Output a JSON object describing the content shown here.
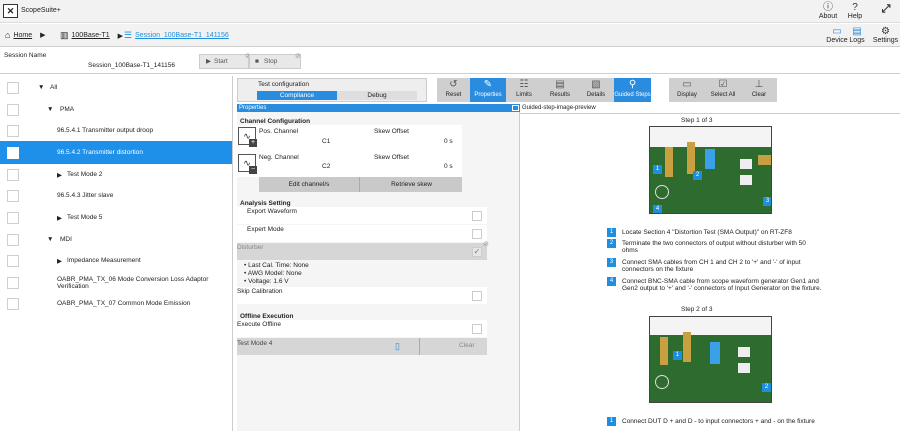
{
  "app": {
    "title": "ScopeSuite+"
  },
  "topbar": {
    "about": "About",
    "help": "Help",
    "device": "Device",
    "logs": "Logs",
    "settings": "Settings"
  },
  "breadcrumb": {
    "home": "Home",
    "test": "100Base-T1",
    "session": "Session_100Base-T1_141156"
  },
  "session": {
    "label": "Session Name",
    "value": "Session_100Base-T1_141156",
    "start": "Start",
    "stop": "Stop"
  },
  "tree": [
    {
      "label": "All",
      "type": "expanded"
    },
    {
      "label": "PMA",
      "type": "expanded"
    },
    {
      "label": "96.5.4.1 Transmitter output droop",
      "type": "leaf"
    },
    {
      "label": "96.5.4.2 Transmitter distortion",
      "type": "leaf",
      "selected": true
    },
    {
      "label": "Test Mode 2",
      "type": "collapsed"
    },
    {
      "label": "96.5.4.3 Jitter slave",
      "type": "leaf"
    },
    {
      "label": "Test Mode 5",
      "type": "collapsed"
    },
    {
      "label": "MDI",
      "type": "expanded"
    },
    {
      "label": "Impedance Measurement",
      "type": "collapsed"
    },
    {
      "label": "OABR_PMA_TX_06 Mode Conversion Loss Adaptor Verification",
      "type": "leaf"
    },
    {
      "label": "OABR_PMA_TX_07 Common Mode Emission",
      "type": "leaf"
    }
  ],
  "toolbar": {
    "config_title": "Test configuration",
    "compliance": "Compliance",
    "debug": "Debug",
    "reset": "Reset",
    "properties": "Properties",
    "limits": "Limits",
    "results": "Results",
    "details": "Details",
    "guided_steps": "Guided Steps",
    "display": "Display",
    "select_all": "Select All",
    "clear": "Clear"
  },
  "properties": {
    "header": "Properties",
    "channel_config": "Channel Configuration",
    "pos_channel": "Pos. Channel",
    "pos_value": "C1",
    "skew_offset": "Skew Offset",
    "pos_skew": "0 s",
    "neg_channel": "Neg. Channel",
    "neg_value": "C2",
    "neg_skew": "0 s",
    "edit_channels": "Edit channel/s",
    "retrieve_skew": "Retrieve skew",
    "analysis_setting": "Analysis Setting",
    "export_waveform": "Export Waveform",
    "expert_mode": "Expert Mode",
    "disturber": "Disturber",
    "last_cal": "Last Cal. Time: None",
    "awg_model": "AWG Model: None",
    "voltage": "Voltage: 1.6 V",
    "skip_calibration": "Skip Calibration",
    "offline_execution": "Offline Execution",
    "execute_offline": "Execute Offline",
    "test_mode": "Test Mode 4",
    "clear": "Clear"
  },
  "preview": {
    "header": "Guided-step-image-preview",
    "step1_title": "Step 1 of 3",
    "step2_title": "Step 2 of 3",
    "steps1": [
      {
        "n": "1",
        "text": "Locate Section 4 \"Distortion Test (SMA Output)\" on RT-ZF8"
      },
      {
        "n": "2",
        "text": "Terminate the two connectors of output without disturber with 50 ohms"
      },
      {
        "n": "3",
        "text": "Connect SMA cables from CH 1 and CH 2 to '+' and '-' of input connectors on the fixture"
      },
      {
        "n": "4",
        "text": "Connect BNC-SMA cable from scope waveform generator Gen1 and Gen2 output to '+' and '-' connectors of Input Generator on the fixture."
      }
    ],
    "steps2": [
      {
        "n": "1",
        "text": "Connect DUT D + and D - to input connectors + and - on the fixture"
      }
    ]
  },
  "colors": {
    "accent": "#2a8cdf",
    "selected": "#1e90ea",
    "board": "#2e6b2e"
  }
}
